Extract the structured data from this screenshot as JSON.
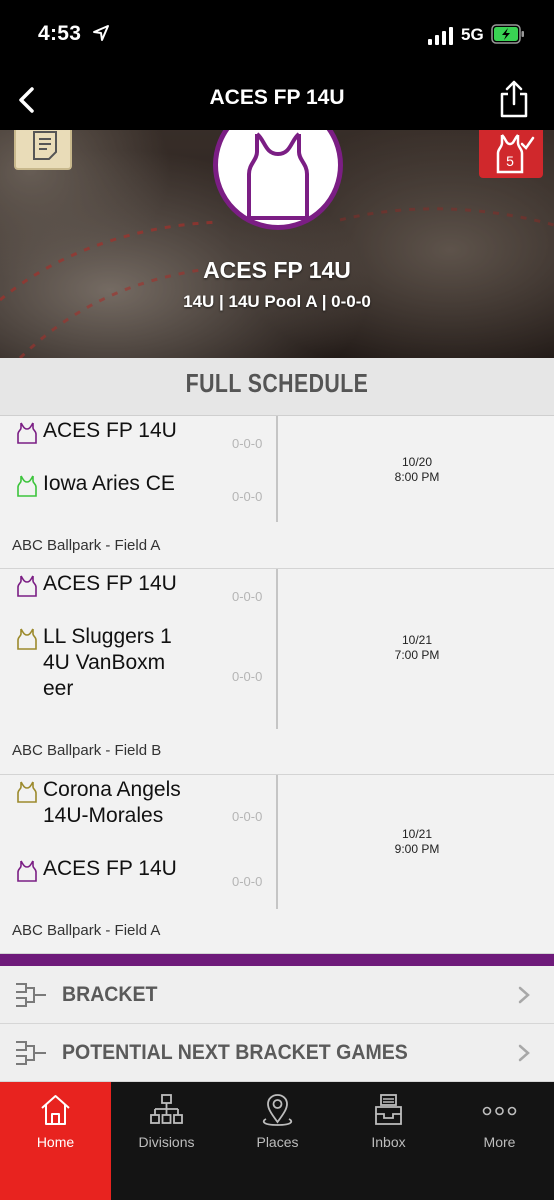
{
  "status_bar": {
    "time": "4:53",
    "network": "5G"
  },
  "nav": {
    "title": "ACES FP 14U"
  },
  "hero": {
    "team_name": "ACES FP 14U",
    "subtitle": "14U | 14U Pool A | 0-0-0",
    "score_badge": "5"
  },
  "section": {
    "title": "FULL SCHEDULE"
  },
  "games": [
    {
      "teams": [
        {
          "name": "ACES FP 14U",
          "record": "0-0-0",
          "icon": "jersey-icon",
          "color": "#7b1e84"
        },
        {
          "name": "Iowa Aries CE",
          "record": "0-0-0",
          "icon": "jersey-icon",
          "color": "#3cc43c"
        }
      ],
      "date": "10/20",
      "time": "8:00 PM",
      "venue": "ABC Ballpark - Field A"
    },
    {
      "teams": [
        {
          "name": "ACES FP 14U",
          "record": "0-0-0",
          "icon": "jersey-icon",
          "color": "#7b1e84"
        },
        {
          "name": "LL Sluggers 14U VanBoxmeer",
          "record": "0-0-0",
          "icon": "jersey-icon",
          "color": "#9c8a2c"
        }
      ],
      "date": "10/21",
      "time": "7:00 PM",
      "venue": "ABC Ballpark - Field B"
    },
    {
      "teams": [
        {
          "name": "Corona Angels 14U-Morales",
          "record": "0-0-0",
          "icon": "jersey-icon",
          "color": "#9c8a2c"
        },
        {
          "name": "ACES FP 14U",
          "record": "0-0-0",
          "icon": "jersey-icon",
          "color": "#7b1e84"
        }
      ],
      "date": "10/21",
      "time": "9:00 PM",
      "venue": "ABC Ballpark - Field A"
    }
  ],
  "links": [
    {
      "label": "BRACKET",
      "icon": "bracket-icon"
    },
    {
      "label": "POTENTIAL NEXT BRACKET GAMES",
      "icon": "bracket-icon"
    }
  ],
  "tabs": [
    {
      "label": "Home",
      "icon": "home-icon",
      "active": true
    },
    {
      "label": "Divisions",
      "icon": "divisions-icon",
      "active": false
    },
    {
      "label": "Places",
      "icon": "location-pin-icon",
      "active": false
    },
    {
      "label": "Inbox",
      "icon": "inbox-icon",
      "active": false
    },
    {
      "label": "More",
      "icon": "more-dots-icon",
      "active": false
    }
  ],
  "colors": {
    "accent": "#e8231f",
    "team_purple": "#7b1e84",
    "accent_bar": "#6e1a7a"
  }
}
